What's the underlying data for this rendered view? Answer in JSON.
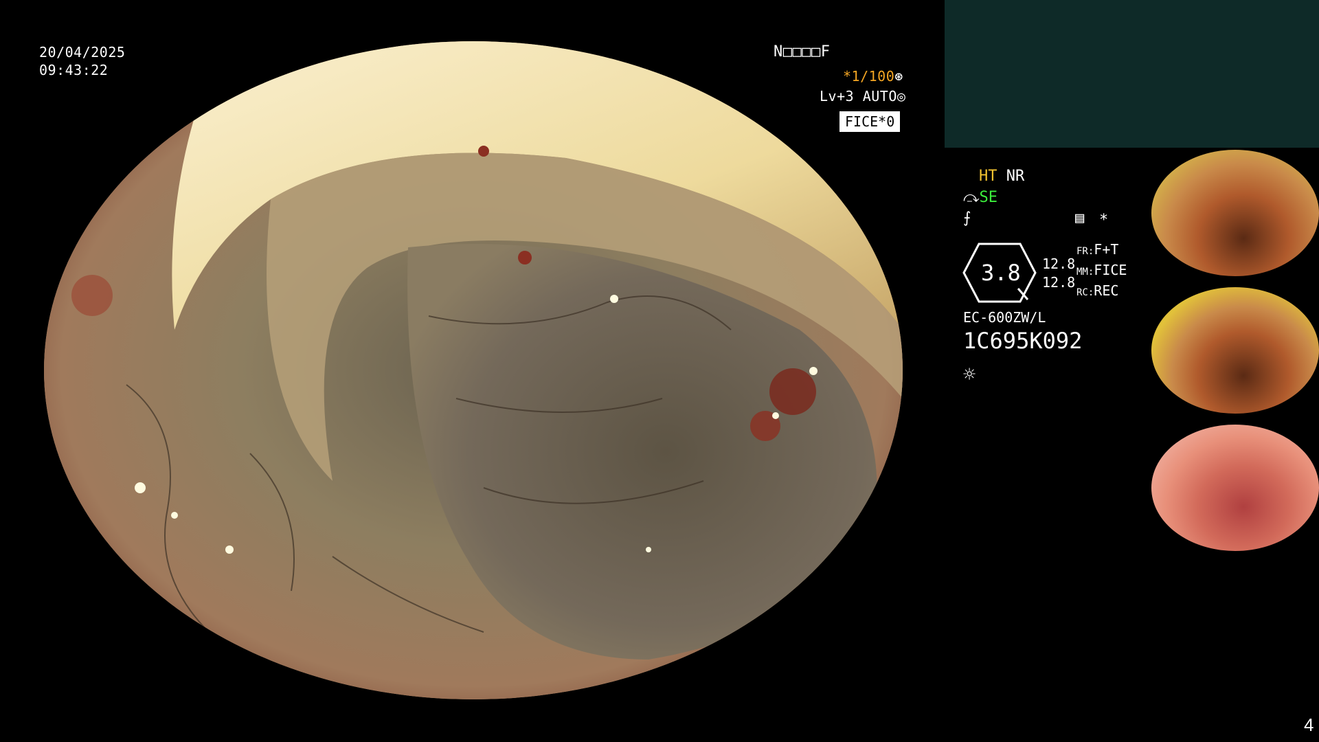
{
  "osd": {
    "date": "20/04/2025",
    "time": "09:43:22",
    "patient_code": "N□□□□F",
    "shutter": "*1/100",
    "level": "Lv+3 AUTO",
    "fice": "FICE*0"
  },
  "panel": {
    "ht": "HT",
    "nr": "NR",
    "se": "SE",
    "asterisk": "*",
    "zoom_value": "3.8",
    "val_a": "12.8",
    "val_b": "12.8",
    "fr_label": "FR:",
    "fr_value": "F+T",
    "mm_label": "MM:",
    "mm_value": "FICE",
    "rc_label": "RC:",
    "rc_value": "REC",
    "scope_model": "EC-600ZW/L",
    "serial": "1C695K092"
  },
  "page_number": "4",
  "thumbnails": [
    {
      "label": "captured-image-1"
    },
    {
      "label": "captured-image-2"
    },
    {
      "label": "captured-image-3"
    }
  ],
  "colors": {
    "panel_bg": "#0e2a28",
    "accent_orange": "#f5a623",
    "accent_green": "#3cf03c",
    "accent_yellow": "#f4c430"
  }
}
